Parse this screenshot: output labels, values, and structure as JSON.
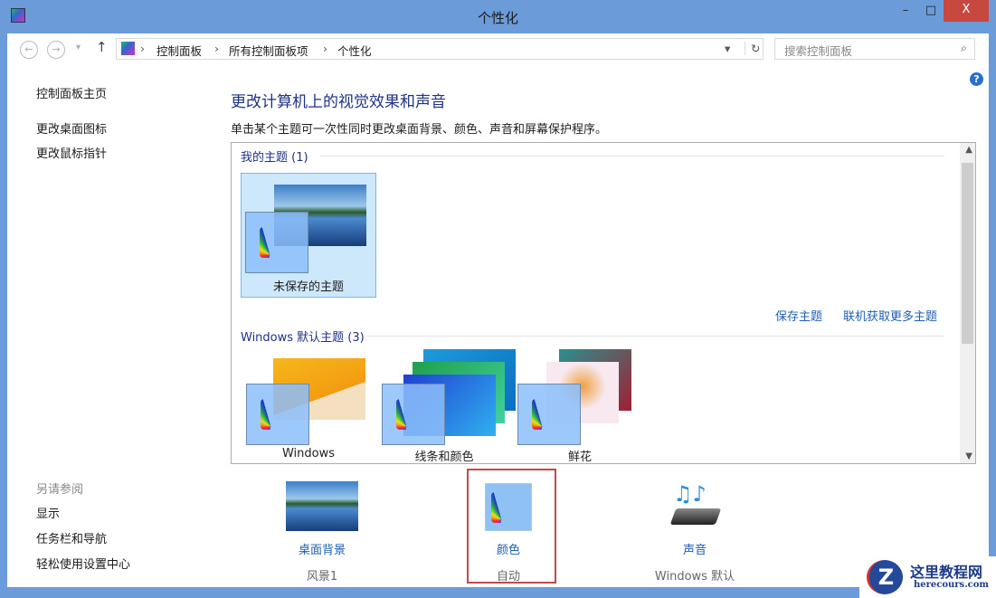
{
  "window": {
    "title": "个性化",
    "close": "X",
    "minimize": "–",
    "maximize": "□"
  },
  "nav": {
    "back": "←",
    "forward": "→",
    "dropdown": "▾",
    "up": "↑",
    "breadcrumb": [
      "控制面板",
      "所有控制面板项",
      "个性化"
    ],
    "sep": "›",
    "refresh": "↻",
    "addr_dropdown": "▾",
    "search_placeholder": "搜索控制面板",
    "search_icon": "⌕"
  },
  "sidebar": {
    "home": "控制面板主页",
    "items": [
      "更改桌面图标",
      "更改鼠标指针"
    ],
    "see_also": "另请参阅",
    "links": [
      "显示",
      "任务栏和导航",
      "轻松使用设置中心"
    ]
  },
  "help": "?",
  "main": {
    "heading": "更改计算机上的视觉效果和声音",
    "description": "单击某个主题可一次性同时更改桌面背景、颜色、声音和屏幕保护程序。",
    "my_themes": {
      "label": "我的主题 (1)",
      "items": [
        "未保存的主题"
      ]
    },
    "save_theme": "保存主题",
    "get_more": "联机获取更多主题",
    "default_themes": {
      "label": "Windows 默认主题 (3)",
      "items": [
        "Windows",
        "线条和颜色",
        "鲜花"
      ]
    }
  },
  "bottom": [
    {
      "name": "桌面背景",
      "value": "风景1"
    },
    {
      "name": "颜色",
      "value": "自动"
    },
    {
      "name": "声音",
      "value": "Windows 默认"
    }
  ],
  "watermark": {
    "title": "这里教程网",
    "url": "herecours.com"
  }
}
